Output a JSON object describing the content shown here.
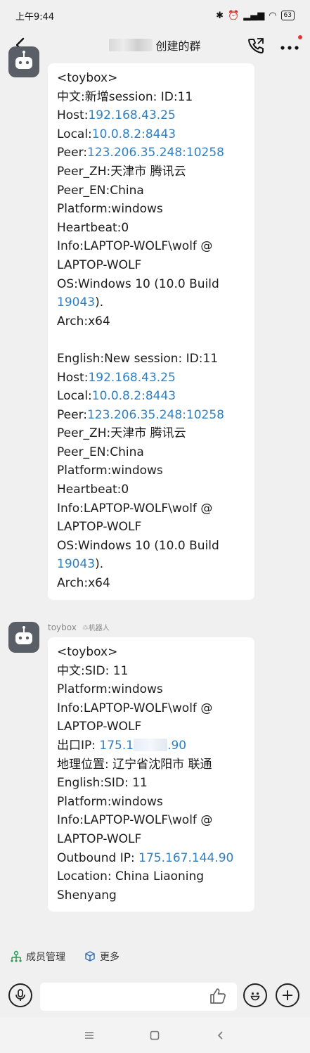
{
  "status_bar": {
    "time": "上午9:44",
    "battery": "63"
  },
  "header": {
    "title": "创建的群"
  },
  "messages": [
    {
      "lines": [
        "<toybox>",
        "中文:新增session: ID:11",
        {
          "label": "Host:",
          "value": "192.168.43.25"
        },
        {
          "label": "Local:",
          "value": "10.0.8.2:8443"
        },
        {
          "label": "Peer:",
          "value": "123.206.35.248:10258"
        },
        "Peer_ZH:天津市 腾讯云",
        "Peer_EN:China",
        "Platform:windows",
        "Heartbeat:0",
        "Info:LAPTOP-WOLF\\wolf @",
        "LAPTOP-WOLF",
        "OS:Windows 10 (10.0 Build",
        {
          "label": "",
          "value": "19043",
          "suffix": ")."
        },
        "Arch:x64",
        "",
        "English:New session: ID:11",
        {
          "label": "Host:",
          "value": "192.168.43.25"
        },
        {
          "label": "Local:",
          "value": "10.0.8.2:8443"
        },
        {
          "label": "Peer:",
          "value": "123.206.35.248:10258"
        },
        "Peer_ZH:天津市 腾讯云",
        "Peer_EN:China",
        "Platform:windows",
        "Heartbeat:0",
        "Info:LAPTOP-WOLF\\wolf @",
        "LAPTOP-WOLF",
        "OS:Windows 10 (10.0 Build",
        {
          "label": "",
          "value": "19043",
          "suffix": ")."
        },
        "Arch:x64"
      ]
    },
    {
      "sender": "toybox",
      "sender_tag": "机器人",
      "lines": [
        "<toybox>",
        "中文:SID: 11",
        "Platform:windows",
        "Info:LAPTOP-WOLF\\wolf @",
        "LAPTOP-WOLF",
        {
          "label": "出口IP: ",
          "value": "175.1",
          "blur": true,
          "suffix_link": ".90"
        },
        "地理位置: 辽宁省沈阳市 联通",
        "English:SID: 11",
        "Platform:windows",
        "Info:LAPTOP-WOLF\\wolf @",
        "LAPTOP-WOLF",
        {
          "label": "Outbound IP: ",
          "value": "175.167.144.90"
        },
        "Location: China Liaoning",
        "Shenyang"
      ]
    }
  ],
  "quick_actions": [
    {
      "label": "成员管理",
      "icon": "members-icon"
    },
    {
      "label": "更多",
      "icon": "cube-icon"
    }
  ],
  "colors": {
    "link": "#2f7fc1",
    "avatar_bg": "#5a5e66",
    "red_dot": "#e53935"
  }
}
